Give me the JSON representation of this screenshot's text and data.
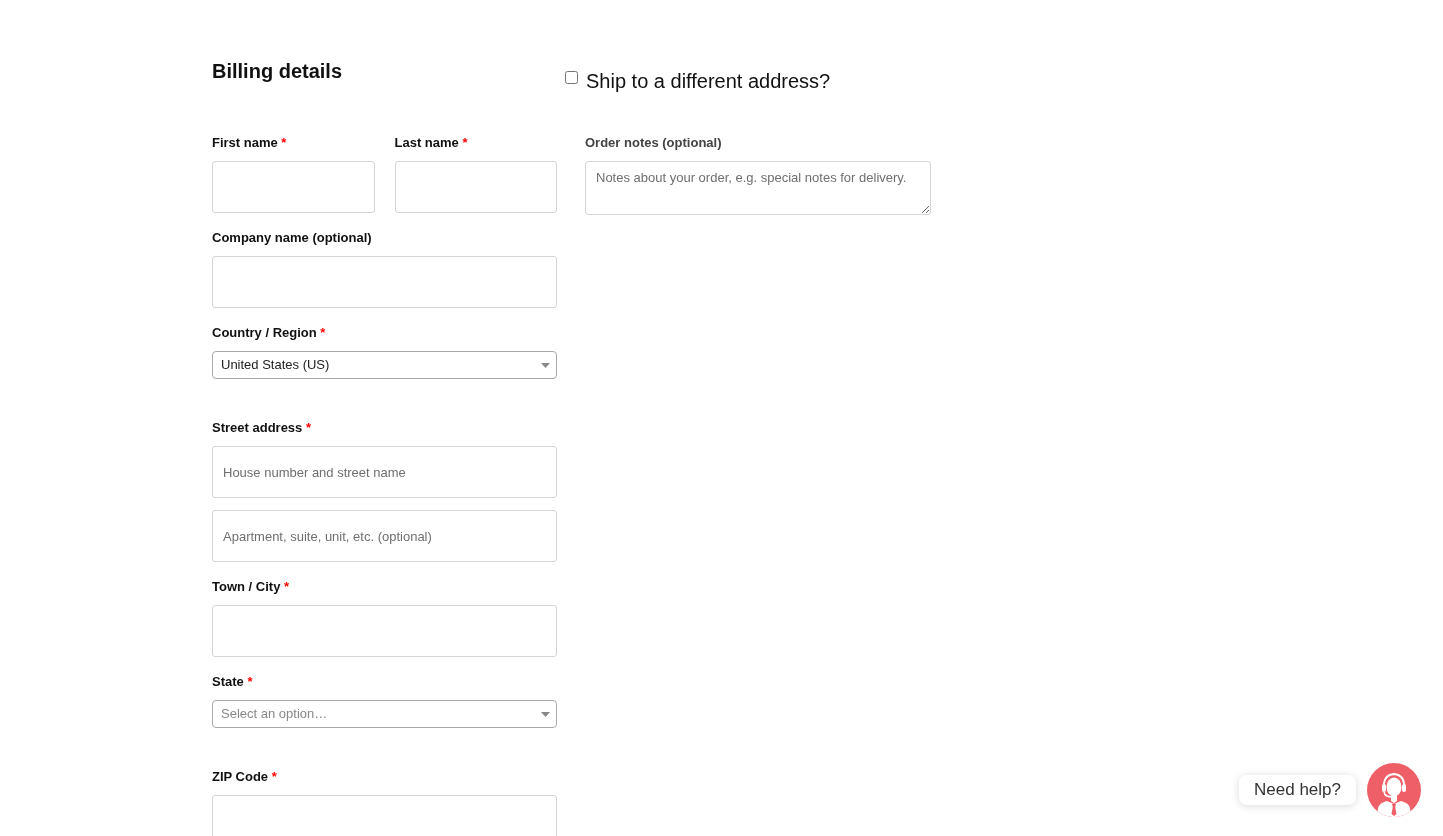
{
  "billing": {
    "title": "Billing details",
    "rows": [
      {
        "fields": [
          {
            "label": "First name",
            "required_mark": "*",
            "kind": "text"
          },
          {
            "label": "Last name",
            "required_mark": "*",
            "kind": "text"
          }
        ]
      },
      {
        "fields": [
          {
            "label": "Company name (optional)",
            "kind": "text"
          }
        ]
      },
      {
        "fields": [
          {
            "label": "Country / Region",
            "required_mark": "*",
            "kind": "select",
            "value": "United States (US)"
          }
        ]
      },
      {
        "fields": [
          {
            "label": "Street address",
            "required_mark": "*",
            "kind": "address",
            "lines": [
              {
                "placeholder": "House number and street name"
              },
              {
                "placeholder": "Apartment, suite, unit, etc. (optional)"
              }
            ]
          }
        ]
      },
      {
        "fields": [
          {
            "label": "Town / City",
            "required_mark": "*",
            "kind": "text"
          }
        ]
      },
      {
        "fields": [
          {
            "label": "State",
            "required_mark": "*",
            "kind": "select",
            "placeholder": "Select an option…"
          }
        ]
      },
      {
        "fields": [
          {
            "label": "ZIP Code",
            "required_mark": "*",
            "kind": "text"
          }
        ]
      }
    ]
  },
  "shipping": {
    "label": "Ship to a different address?",
    "checked": false
  },
  "order_notes": {
    "label": "Order notes (optional)",
    "placeholder": "Notes about your order, e.g. special notes for delivery."
  },
  "help_widget": {
    "label": "Need help?"
  }
}
